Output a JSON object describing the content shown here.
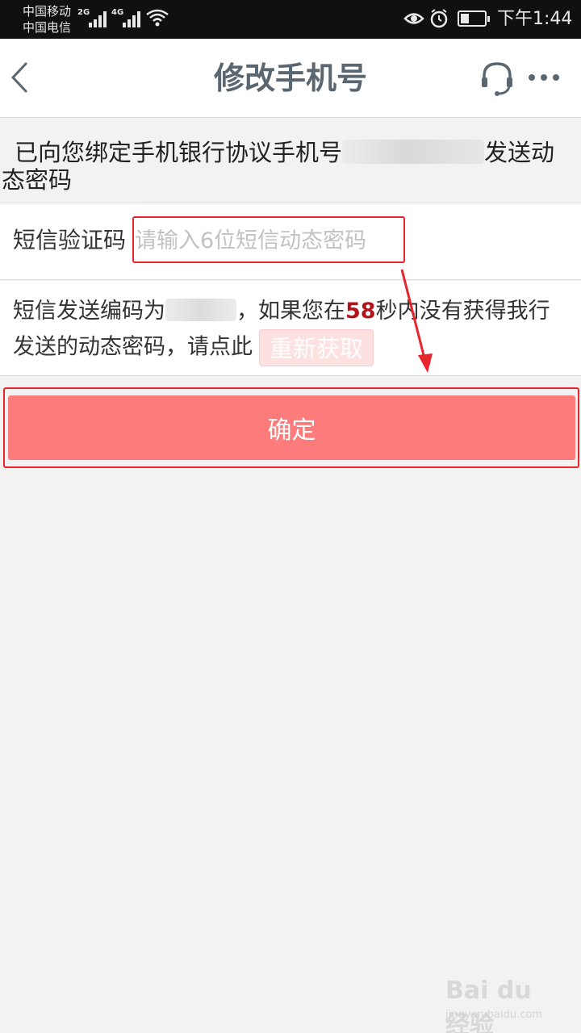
{
  "status_bar": {
    "carrier_1": "中国移动",
    "carrier_2": "中国电信",
    "network_1": "2G",
    "network_2": "4G",
    "time": "下午1:44"
  },
  "nav": {
    "title": "修改手机号",
    "back_icon": "chevron-left-icon",
    "support_icon": "headset-icon",
    "more_icon": "more-dots-icon"
  },
  "notice": {
    "line1_prefix": "已向您绑定手机银行协议手机号",
    "line1_suffix": "发送动",
    "line2": "态密码"
  },
  "sms": {
    "label": "短信验证码",
    "placeholder": "请输入6位短信动态密码",
    "value": ""
  },
  "send_info": {
    "prefix": "短信发送编码为",
    "middle": "，如果您在",
    "countdown": "58",
    "suffix": "秒内没有获得我行",
    "line2": "发送的动态密码，请点此",
    "resend_label": "重新获取"
  },
  "confirm_label": "确定",
  "watermark": {
    "brand": "Bai du 经验",
    "url": "jingyan.baidu.com"
  },
  "colors": {
    "accent": "#fe7b7b",
    "countdown": "#b3141b",
    "annotation": "#e8242c"
  }
}
